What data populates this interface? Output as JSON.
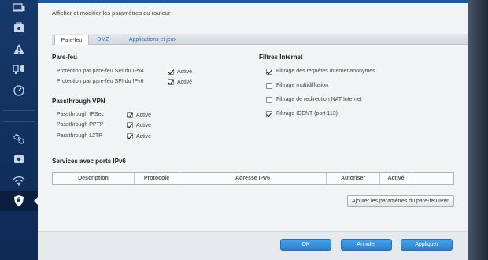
{
  "page": {
    "subtitle": "Afficher et modifier les paramètres du routeur"
  },
  "tabs": [
    {
      "label": "Pare-feu",
      "active": true
    },
    {
      "label": "DMZ",
      "active": false
    },
    {
      "label": "Applications et jeux",
      "active": false
    }
  ],
  "firewall": {
    "title": "Pare-feu",
    "items": [
      {
        "label": "Protection par pare-feu SPI du IPv4",
        "checkbox_label": "Activé",
        "checked": true
      },
      {
        "label": "Protection par pare-feu SPI du IPv6",
        "checkbox_label": "Activé",
        "checked": true
      }
    ]
  },
  "vpn": {
    "title": "Passthrough VPN",
    "items": [
      {
        "label": "Passthrough IPSec",
        "checkbox_label": "Activé",
        "checked": true
      },
      {
        "label": "Passthrough PPTP",
        "checkbox_label": "Activé",
        "checked": true
      },
      {
        "label": "Passthrough L2TP",
        "checkbox_label": "Activé",
        "checked": true
      }
    ]
  },
  "internet_filters": {
    "title": "Filtres Internet",
    "items": [
      {
        "label": "Filtrage des requêtes Internet anonymes",
        "checked": true
      },
      {
        "label": "Filtrage multidiffusion",
        "checked": false
      },
      {
        "label": "Filtrage de redirection NAT Internet",
        "checked": false
      },
      {
        "label": "Filtrage IDENT (port 113)",
        "checked": true
      }
    ]
  },
  "ipv6": {
    "title": "Services avec ports IPv6",
    "columns": [
      "Description",
      "Protocole",
      "Adresse IPv6",
      "Autoriser",
      "Activé"
    ],
    "add_button": "Ajouter les paramètres du pare-feu IPv6"
  },
  "footer": {
    "ok": "OK",
    "cancel": "Annuler",
    "apply": "Appliquer"
  },
  "colors": {
    "nav_bg": "#17386b",
    "accent_blue": "#2b7fc9",
    "link_blue": "#2a6ab0",
    "panel_bg": "#f1f3f5"
  },
  "nav": [
    {
      "icon": "devices-icon"
    },
    {
      "icon": "parental-controls-icon"
    },
    {
      "icon": "warning-icon"
    },
    {
      "icon": "media-prioritization-icon"
    },
    {
      "icon": "speed-test-icon"
    },
    {
      "icon": "settings-icon"
    },
    {
      "icon": "usb-storage-icon"
    },
    {
      "icon": "wireless-icon"
    },
    {
      "icon": "security-shield-icon"
    }
  ]
}
